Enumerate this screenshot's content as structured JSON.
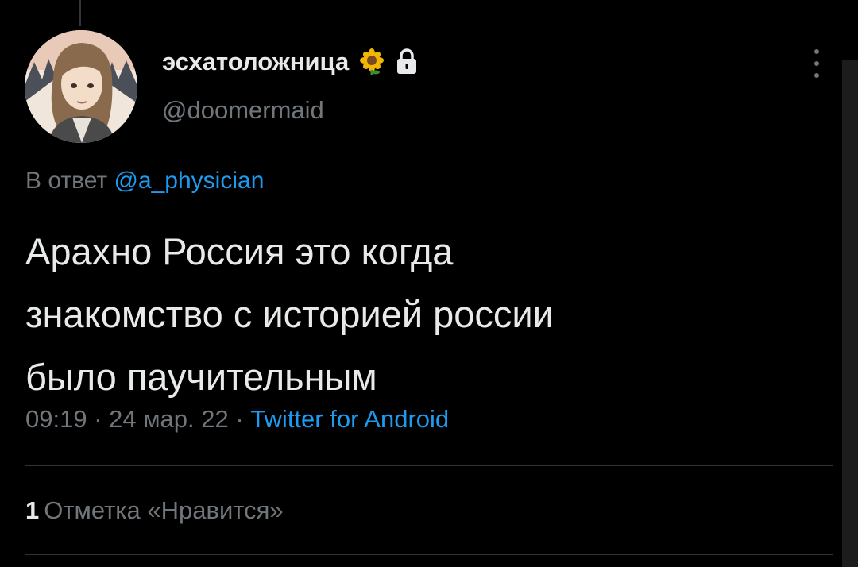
{
  "author": {
    "display_name": "эсхатоложница",
    "handle": "@doomermaid",
    "badge_icons": [
      "sunflower-icon",
      "lock-icon"
    ]
  },
  "reply": {
    "prefix": "В ответ",
    "mention": "@a_physician"
  },
  "tweet": {
    "lines": [
      "Арахно Россия это когда",
      "знакомство с историей россии",
      "было паучительным"
    ]
  },
  "meta": {
    "time": "09:19",
    "sep1": " · ",
    "date": "24 мар. 22",
    "sep2": " · ",
    "source": "Twitter for Android"
  },
  "stats": {
    "likes_count": "1",
    "likes_label": "Отметка «Нравится»"
  },
  "colors": {
    "background": "#000000",
    "text": "#e7e9ea",
    "secondary": "#71767b",
    "accent": "#1d9bf0",
    "divider": "#2f3336"
  }
}
